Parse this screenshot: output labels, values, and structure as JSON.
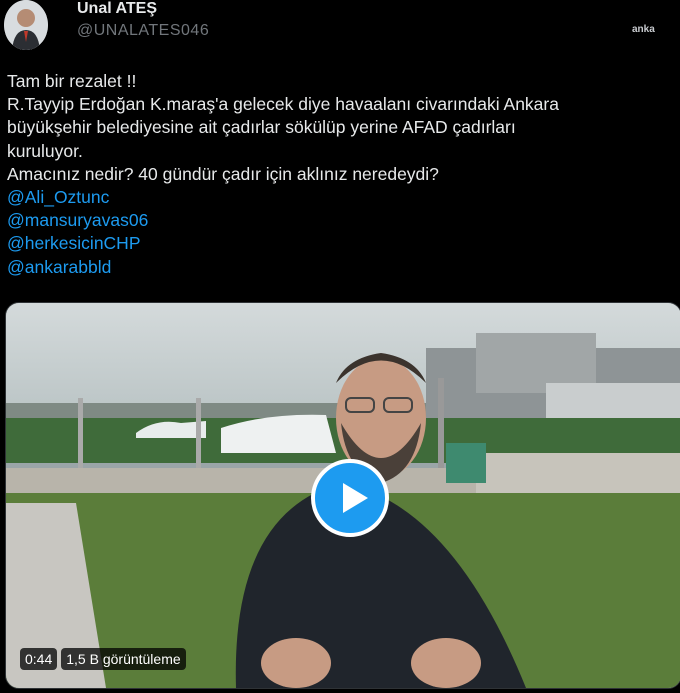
{
  "author": {
    "name": "Unal ATEŞ",
    "handle": "@UNALATES046"
  },
  "watermark": "anka",
  "tweet": {
    "lines": [
      "Tam bir rezalet !!",
      "R.Tayyip Erdoğan K.maraş'a gelecek diye havaalanı civarındaki Ankara",
      "büyükşehir belediyesine ait çadırlar sökülüp yerine AFAD çadırları",
      "kuruluyor.",
      "Amacınız nedir? 40 gündür çadır için aklınız neredeydi?"
    ],
    "mentions": [
      "@Ali_Oztunc",
      "@mansuryavas06",
      "@herkesicinCHP",
      "@ankarabbld"
    ]
  },
  "video": {
    "duration": "0:44",
    "views": "1,5 B görüntüleme"
  },
  "colors": {
    "background": "#000000",
    "text": "#e7e9ea",
    "secondary": "#71767b",
    "link": "#1d9bf0",
    "play_button": "#1d9bf0"
  },
  "icons": [
    "avatar",
    "play-icon"
  ]
}
